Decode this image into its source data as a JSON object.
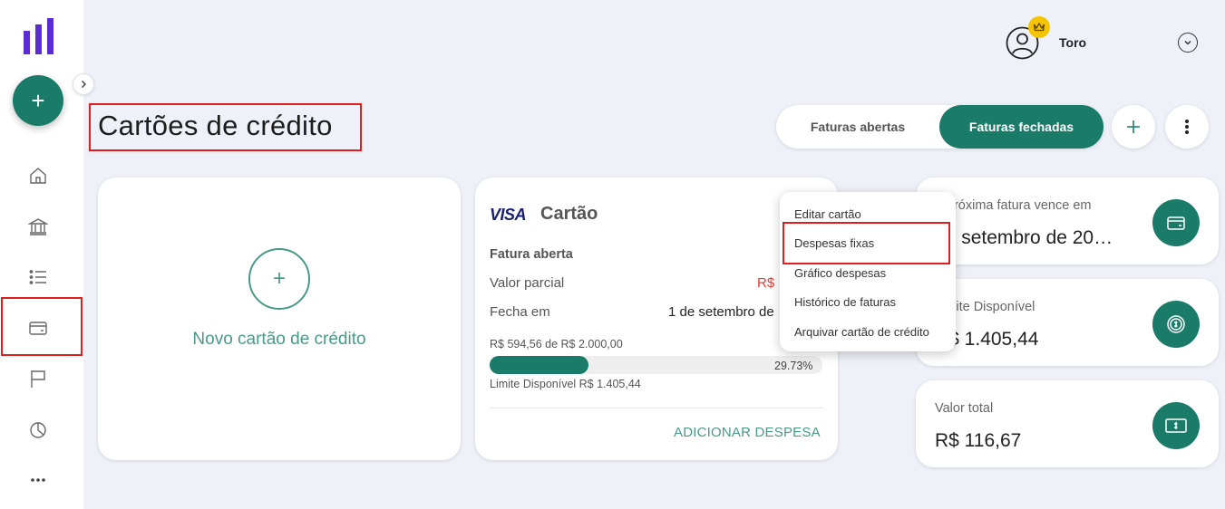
{
  "colors": {
    "accent": "#197b68",
    "highlight": "#e01e1e",
    "negative": "#e53935",
    "crown": "#f5c400"
  },
  "sidebar": {
    "items": [
      {
        "name": "home",
        "icon": "home-icon"
      },
      {
        "name": "accounts",
        "icon": "bank-icon"
      },
      {
        "name": "transactions",
        "icon": "list-icon"
      },
      {
        "name": "credit-cards",
        "icon": "credit-card-icon",
        "selected": true
      },
      {
        "name": "goals",
        "icon": "flag-icon"
      },
      {
        "name": "reports",
        "icon": "pie-chart-icon"
      },
      {
        "name": "more",
        "icon": "more-icon"
      }
    ]
  },
  "header": {
    "user_name": "Toro"
  },
  "page": {
    "title": "Cartões de crédito"
  },
  "toggle": {
    "open_label": "Faturas abertas",
    "closed_label": "Faturas fechadas",
    "active": "closed"
  },
  "new_card": {
    "label": "Novo cartão de crédito"
  },
  "credit_card": {
    "brand": "VISA",
    "name": "Cartão",
    "section": "Fatura aberta",
    "partial_label": "Valor parcial",
    "partial_value": "R$",
    "closes_label": "Fecha em",
    "closes_value": "1 de setembro de",
    "progress_caption": "R$ 594,56 de R$ 2.000,00",
    "progress": 29.73,
    "progress_pct": "29.73%",
    "limit_caption": "Limite Disponível R$ 1.405,44",
    "add_expense": "ADICIONAR DESPESA"
  },
  "menu": {
    "items": [
      "Editar cartão",
      "Despesas fixas",
      "Gráfico despesas",
      "Histórico de faturas",
      "Arquivar cartão de crédito"
    ]
  },
  "info_cards": [
    {
      "label": "A próxima fatura vence em",
      "value": "de setembro de 20…",
      "icon": "wallet-icon"
    },
    {
      "label": "Limite Disponível",
      "value": "R$ 1.405,44",
      "icon": "coin-icon"
    },
    {
      "label": "Valor total",
      "value": "R$ 116,67",
      "icon": "cash-icon"
    }
  ]
}
